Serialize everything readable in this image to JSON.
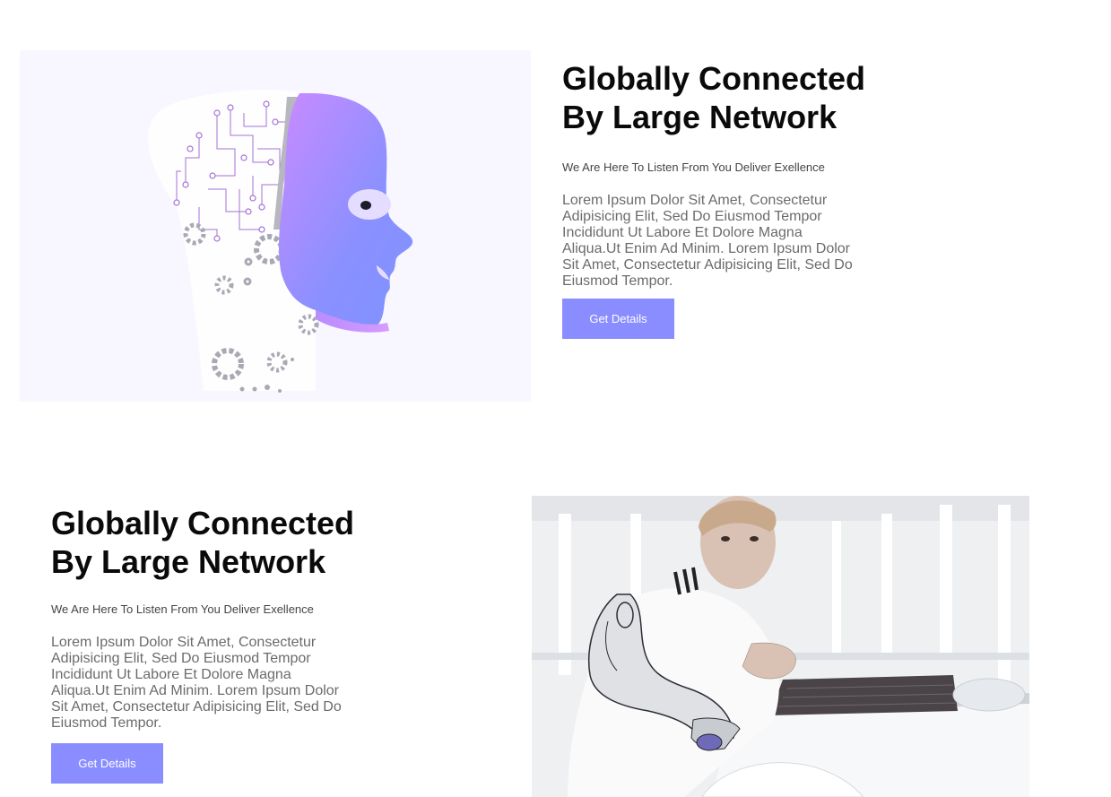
{
  "sections": [
    {
      "title_line1": "Globally Connected",
      "title_line2": "By Large Network",
      "subtitle": "We Are Here To Listen From You Deliver Exellence",
      "body": "Lorem Ipsum Dolor Sit Amet, Consectetur Adipisicing Elit, Sed Do Eiusmod Tempor Incididunt Ut Labore Et Dolore Magna Aliqua.Ut Enim Ad Minim. Lorem Ipsum Dolor Sit Amet, Consectetur Adipisicing Elit, Sed Do Eiusmod Tempor.",
      "button_label": "Get Details",
      "image_icon": "ai-head-illustration"
    },
    {
      "title_line1": "Globally Connected",
      "title_line2": "By Large Network",
      "subtitle": "We Are Here To Listen From You Deliver Exellence",
      "body": "Lorem Ipsum Dolor Sit Amet, Consectetur Adipisicing Elit, Sed Do Eiusmod Tempor Incididunt Ut Labore Et Dolore Magna Aliqua.Ut Enim Ad Minim. Lorem Ipsum Dolor Sit Amet, Consectetur Adipisicing Elit, Sed Do Eiusmod Tempor.",
      "button_label": "Get Details",
      "image_icon": "cyborg-photo"
    }
  ],
  "colors": {
    "accent": "#8a8dff",
    "illustration_bg": "#f8f7ff",
    "face_gradient_start": "#c98bff",
    "face_gradient_end": "#7f93ff",
    "gear_gray": "#a9a9b3",
    "circuit_purple": "#a472d6"
  }
}
